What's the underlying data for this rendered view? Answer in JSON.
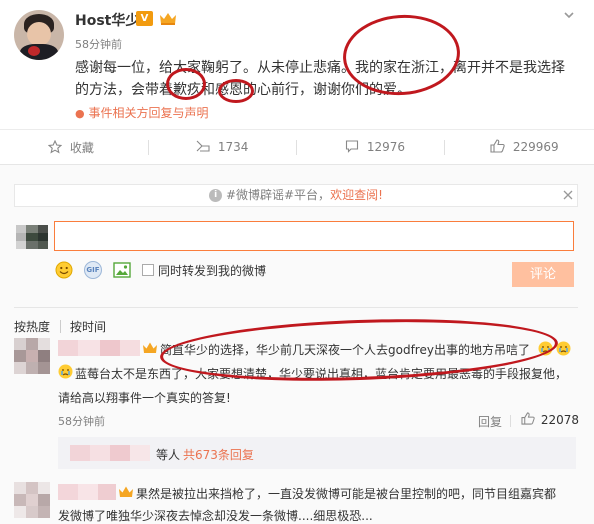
{
  "post": {
    "username": "Host华少",
    "time": "58分钟前",
    "text_line1": "感谢每一位，给大家鞠躬了。从未停止悲痛。我的家在浙江，离开并不是我选择",
    "text_line2": "的方法，会带着歉疚和感恩的心前行，谢谢你们的爱。",
    "related_link": "事件相关方回复与声明",
    "menu_icon": "chevron-down-icon"
  },
  "actions": {
    "favorite": "收藏",
    "repost_count": "1734",
    "comment_count": "12976",
    "like_count": "229969"
  },
  "rumor_bar": {
    "tag": "#微博辟谣#平台，",
    "link": "欢迎查阅!"
  },
  "composer": {
    "input_value": "",
    "repost_label": "同时转发到我的微博",
    "submit_label": "评论"
  },
  "sort": {
    "by_heat": "按热度",
    "by_time": "按时间"
  },
  "comments": [
    {
      "text_line1": "简直华少的选择，华少前几天深夜一个人去godfrey出事的地方吊唁了",
      "text_line2": "蓝莓台太不是东西了，大家要想清楚，华少要说出真相，蓝台肯定要用最恶毒的手段报复他，",
      "text_line3": "请给高以翔事件一个真实的答复!",
      "time": "58分钟前",
      "reply_label": "回复",
      "likes": "22078",
      "sub_prefix": "等人",
      "sub_link": "共673条回复"
    },
    {
      "text_line1": "果然是被拉出来挡枪了，一直没发微博可能是被台里控制的吧，同节目组嘉宾都",
      "text_line2": "发微博了唯独华少深夜去悼念却没发一条微博....细思极恐..."
    }
  ],
  "colors": {
    "accent": "#fa7d3c",
    "link": "#eb7350",
    "annotation": "#c0181e"
  }
}
